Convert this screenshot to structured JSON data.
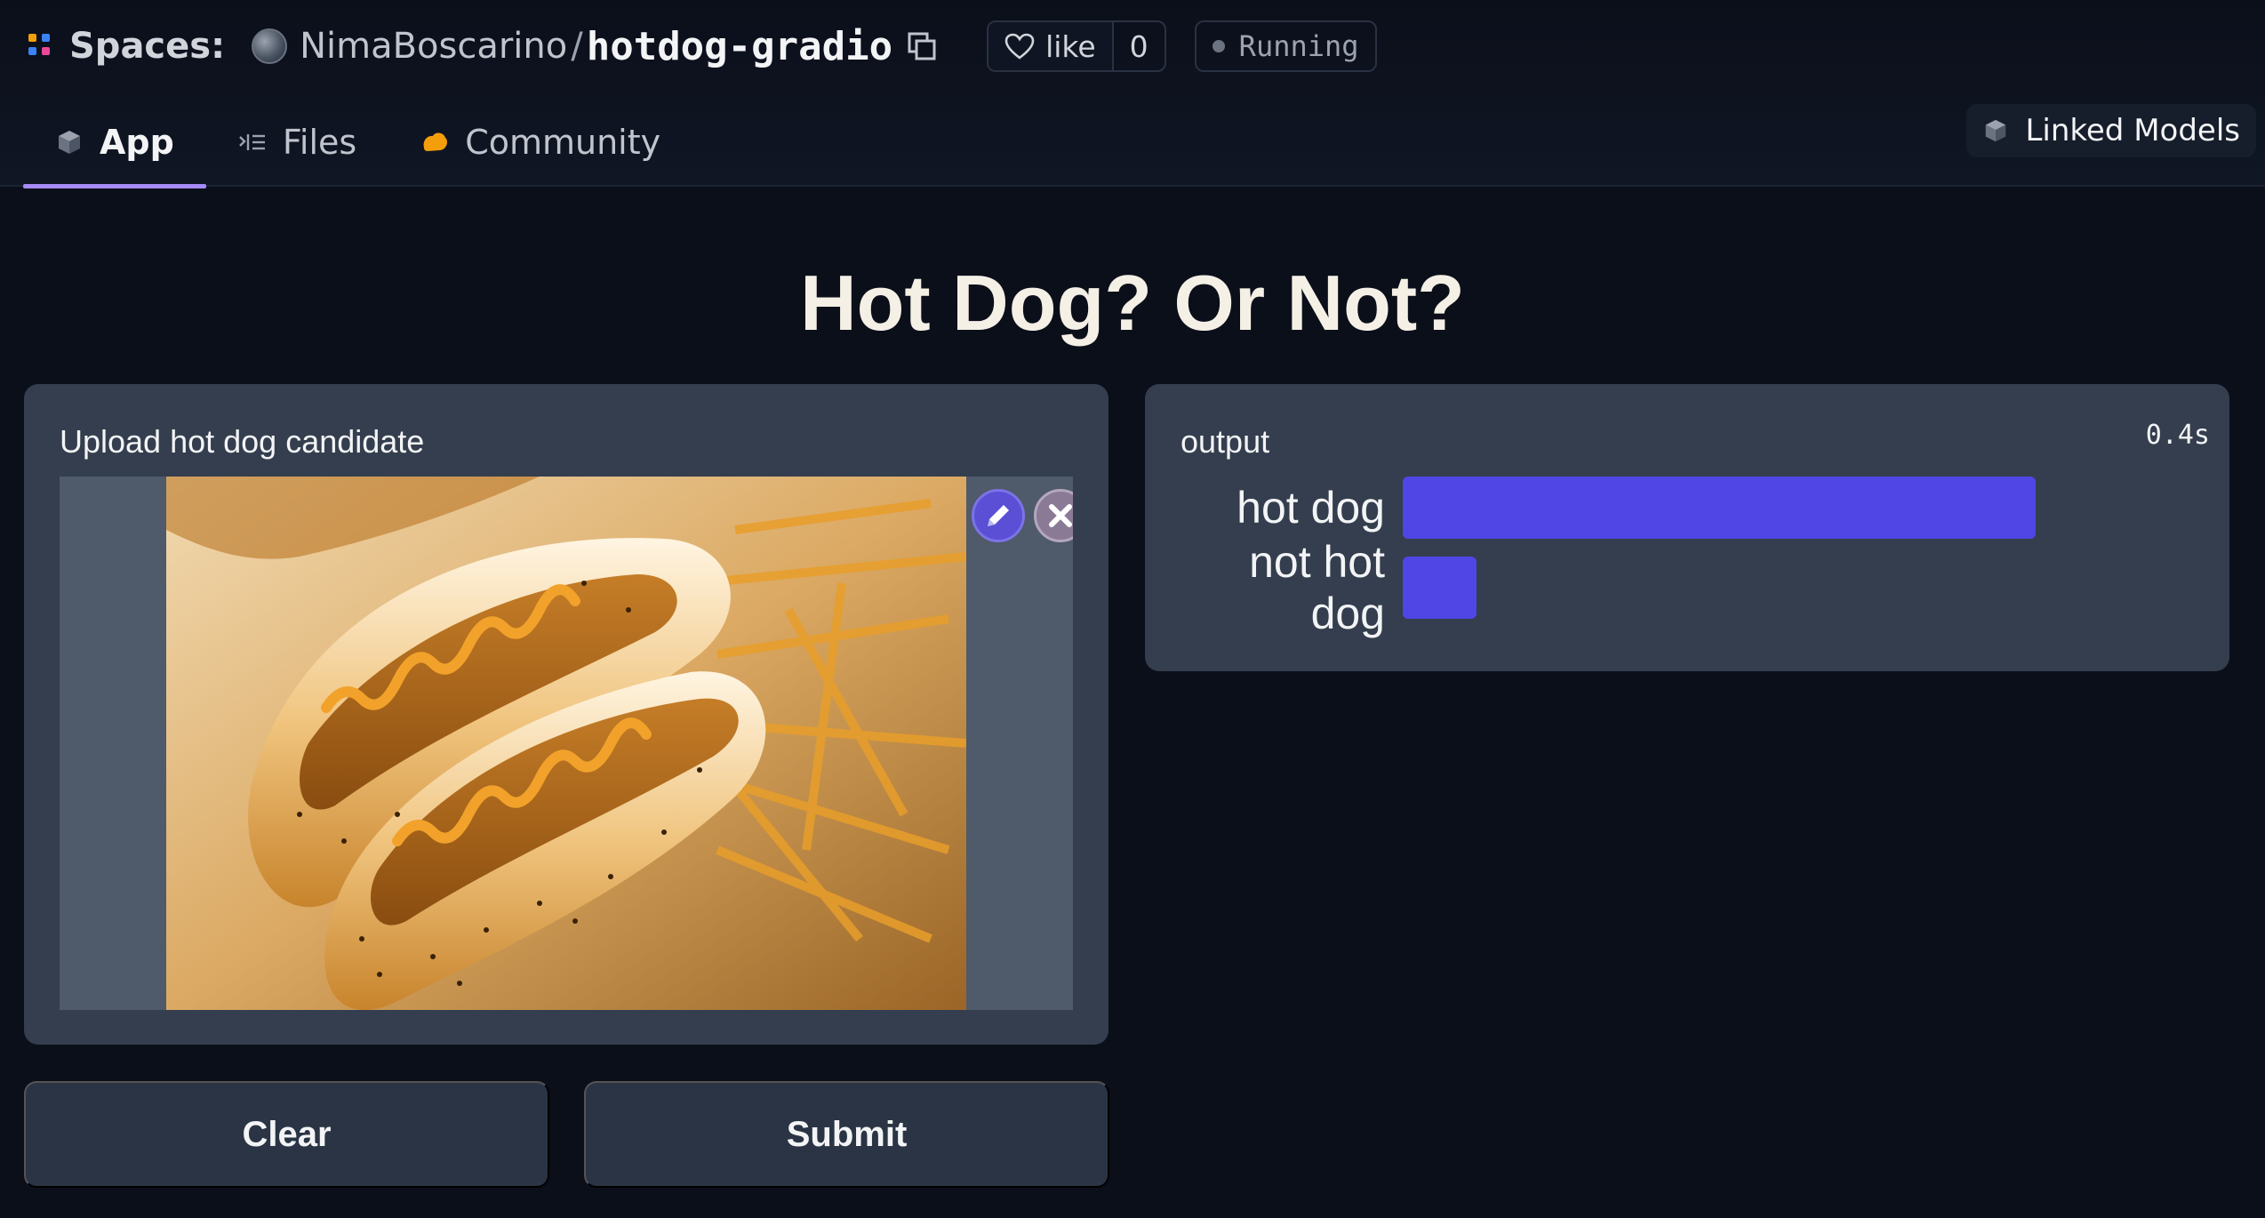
{
  "header": {
    "spaces_label": "Spaces:",
    "owner": "NimaBoscarino",
    "separator": "/",
    "repo": "hotdog-gradio",
    "like_label": "like",
    "like_count": "0",
    "status": "Running"
  },
  "tabs": [
    {
      "label": "App",
      "icon": "cube-icon",
      "active": true
    },
    {
      "label": "Files",
      "icon": "files-icon",
      "active": false
    },
    {
      "label": "Community",
      "icon": "community-icon",
      "active": false
    }
  ],
  "linked_models_label": "Linked Models",
  "app": {
    "title": "Hot Dog? Or Not?",
    "input_label": "Upload hot dog candidate",
    "output_label": "output",
    "elapsed": "0.4s",
    "results": [
      {
        "label": "hot dog",
        "confidence": 0.895
      },
      {
        "label": "not hot dog",
        "confidence": 0.105
      }
    ],
    "clear_label": "Clear",
    "submit_label": "Submit"
  },
  "colors": {
    "accent": "#4f46e5",
    "tab_underline": "#a78bfa",
    "panel": "#343e4e",
    "background": "#0b0f1a"
  }
}
